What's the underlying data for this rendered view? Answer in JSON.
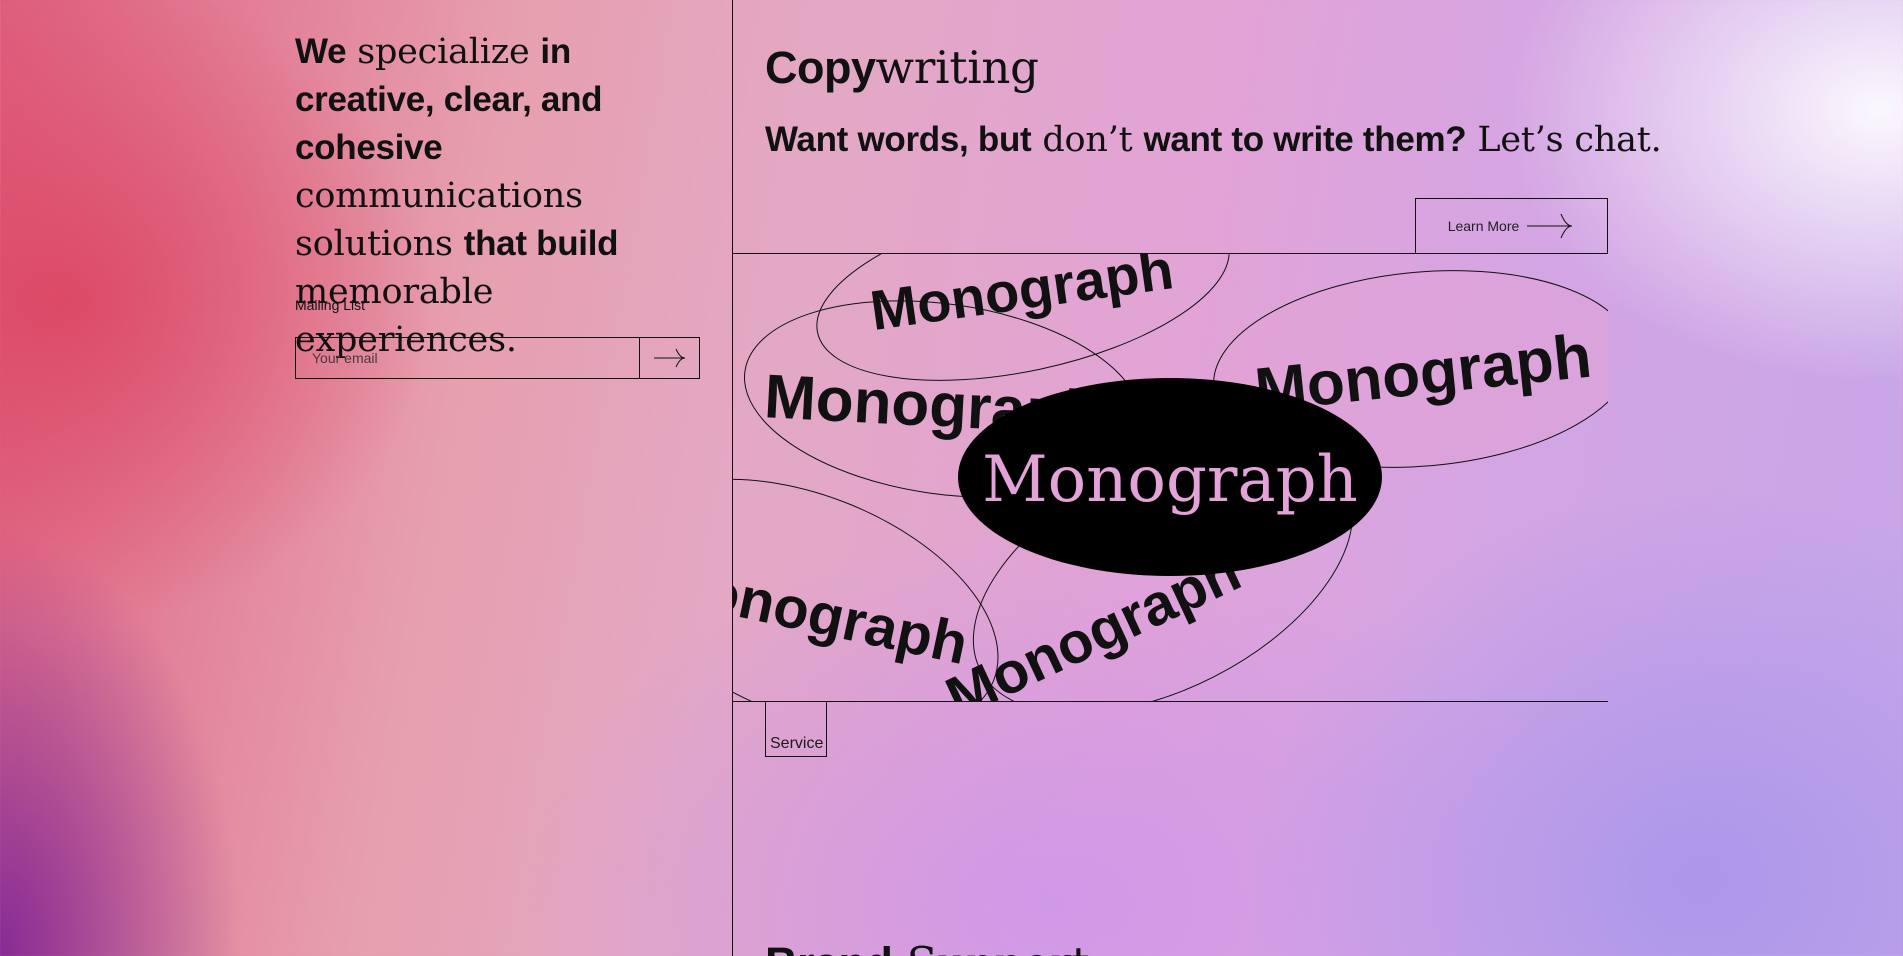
{
  "intro": {
    "t1": "We",
    "t2": " specialize ",
    "t3": "in creative, clear, and cohesive",
    "t4": " communications solutions ",
    "t5": "that build",
    "t6": " memorable experiences."
  },
  "mailing": {
    "label": "Mailing List",
    "placeholder": "Your email",
    "submit_icon": "arrow-right-icon"
  },
  "service": {
    "title_part1": "Copy",
    "title_part2": "writing",
    "tag_part1": "Want words, but",
    "tag_part2": " don’t ",
    "tag_part3": "want to write them?",
    "tag_part4": " Let’s chat.",
    "button_label": "Learn More",
    "button_icon": "arrow-right-icon",
    "tag_label": "Service"
  },
  "illustration": {
    "word": "Monograph",
    "center_fill": "#000000",
    "center_text_color": "#e3a3d8"
  },
  "next_section": {
    "title_part1": "Brand",
    "title_part2": " Support"
  },
  "colors": {
    "text": "#111111",
    "line": "#111111"
  }
}
